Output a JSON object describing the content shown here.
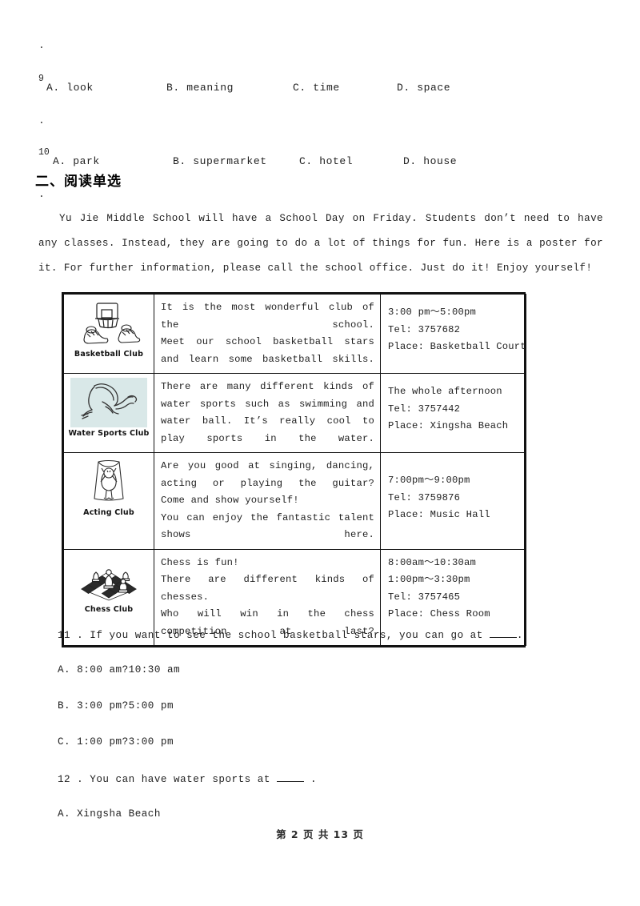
{
  "top_questions": {
    "leading_dot": ".",
    "items": [
      {
        "number": "9",
        "trailing_dot": ".",
        "options": [
          "A. look",
          "B. meaning",
          "C. time",
          "D. space"
        ]
      },
      {
        "number": "10",
        "trailing_dot": ".",
        "options": [
          "A. park",
          "B. supermarket",
          "C. hotel",
          "D. house"
        ]
      }
    ]
  },
  "section": {
    "heading": "二、阅读单选"
  },
  "passage": {
    "text": "Yu Jie Middle School will have a School Day on Friday. Students don’t need to have any classes. Instead, they are going to do a lot of things for fun. Here is a poster for it. For further information, please call the school office. Just do it! Enjoy yourself!"
  },
  "poster": {
    "rows": [
      {
        "club": "Basketball Club",
        "icon": "basketball-hoop-icon",
        "tinted": false,
        "description_lines": [
          "It is the most wonderful club of the school.",
          "Meet our school basketball stars and learn some basketball skills."
        ],
        "info": [
          "3:00 pm〜5:00pm",
          "Tel: 3757682",
          "Place: Basketball Court"
        ]
      },
      {
        "club": "Water Sports Club",
        "icon": "diver-swimmer-icon",
        "tinted": true,
        "description_lines": [
          "There are many different kinds of water sports such as swimming and water ball. It’s really cool to play sports in the water."
        ],
        "info": [
          "The whole afternoon",
          "Tel: 3757442",
          "Place: Xingsha Beach"
        ]
      },
      {
        "club": "Acting Club",
        "icon": "performer-costume-icon",
        "tinted": false,
        "description_lines": [
          "Are you good at singing, dancing, acting or playing the guitar?",
          "Come and show yourself!",
          "You can enjoy the fantastic talent shows here."
        ],
        "info": [
          "7:00pm〜9:00pm",
          "Tel: 3759876",
          "Place: Music Hall"
        ]
      },
      {
        "club": "Chess Club",
        "icon": "chessboard-icon",
        "tinted": false,
        "description_lines": [
          "Chess is fun!",
          "There are different kinds of chesses.",
          "Who will win in the chess competition at last?"
        ],
        "info": [
          "8:00am〜10:30am",
          "1:00pm〜3:30pm",
          "Tel: 3757465",
          "Place: Chess Room"
        ]
      }
    ]
  },
  "reading_questions": [
    {
      "stem_before": "11 .  If you want to see the school basketball stars, you can go at",
      "stem_after": ".",
      "choices": [
        "A. 8:00 am?10:30 am",
        "B. 3:00 pm?5:00 pm",
        "C. 1:00 pm?3:00 pm"
      ]
    },
    {
      "stem_before": "12 .  You can have water sports at",
      "stem_after": ".",
      "choices": [
        "A. Xingsha Beach"
      ]
    }
  ],
  "footer": {
    "text": "第 2 页 共 13 页"
  }
}
